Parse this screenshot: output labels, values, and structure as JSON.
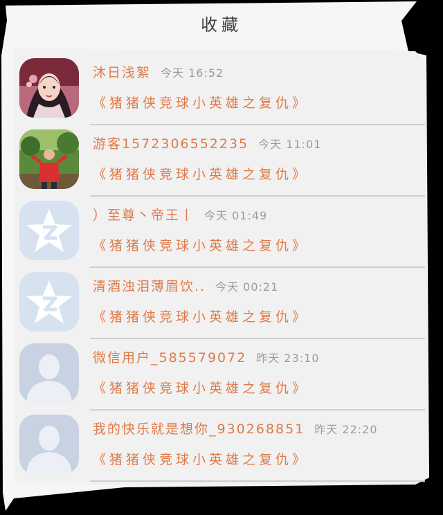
{
  "page": {
    "title": "收藏"
  },
  "items": [
    {
      "name": "沐日浅絮",
      "time": "今天 16:52",
      "message": "《猪猪侠竞球小英雄之复仇》",
      "avatar": "anime-girl-avatar"
    },
    {
      "name": "游客1572306552235",
      "time": "今天 11:01",
      "message": "《猪猪侠竞球小英雄之复仇》",
      "avatar": "photo-person-avatar"
    },
    {
      "name": "）至尊丶帝王丨",
      "time": "今天 01:49",
      "message": "《猪猪侠竞球小英雄之复仇》",
      "avatar": "qzone-star-avatar"
    },
    {
      "name": "清酒浊泪薄眉饮..",
      "time": "今天 00:21",
      "message": "《猪猪侠竞球小英雄之复仇》",
      "avatar": "qzone-star-avatar"
    },
    {
      "name": "微信用户_585579072",
      "time": "昨天 23:10",
      "message": "《猪猪侠竞球小英雄之复仇》",
      "avatar": "default-user-avatar"
    },
    {
      "name": "我的快乐就是想你_930268851",
      "time": "昨天 22:20",
      "message": "《猪猪侠竞球小英雄之复仇》",
      "avatar": "default-user-avatar"
    }
  ],
  "colors": {
    "accent": "#e07a48",
    "muted": "#9b9b9b",
    "background": "#000000",
    "card": "#f6f6f6"
  }
}
